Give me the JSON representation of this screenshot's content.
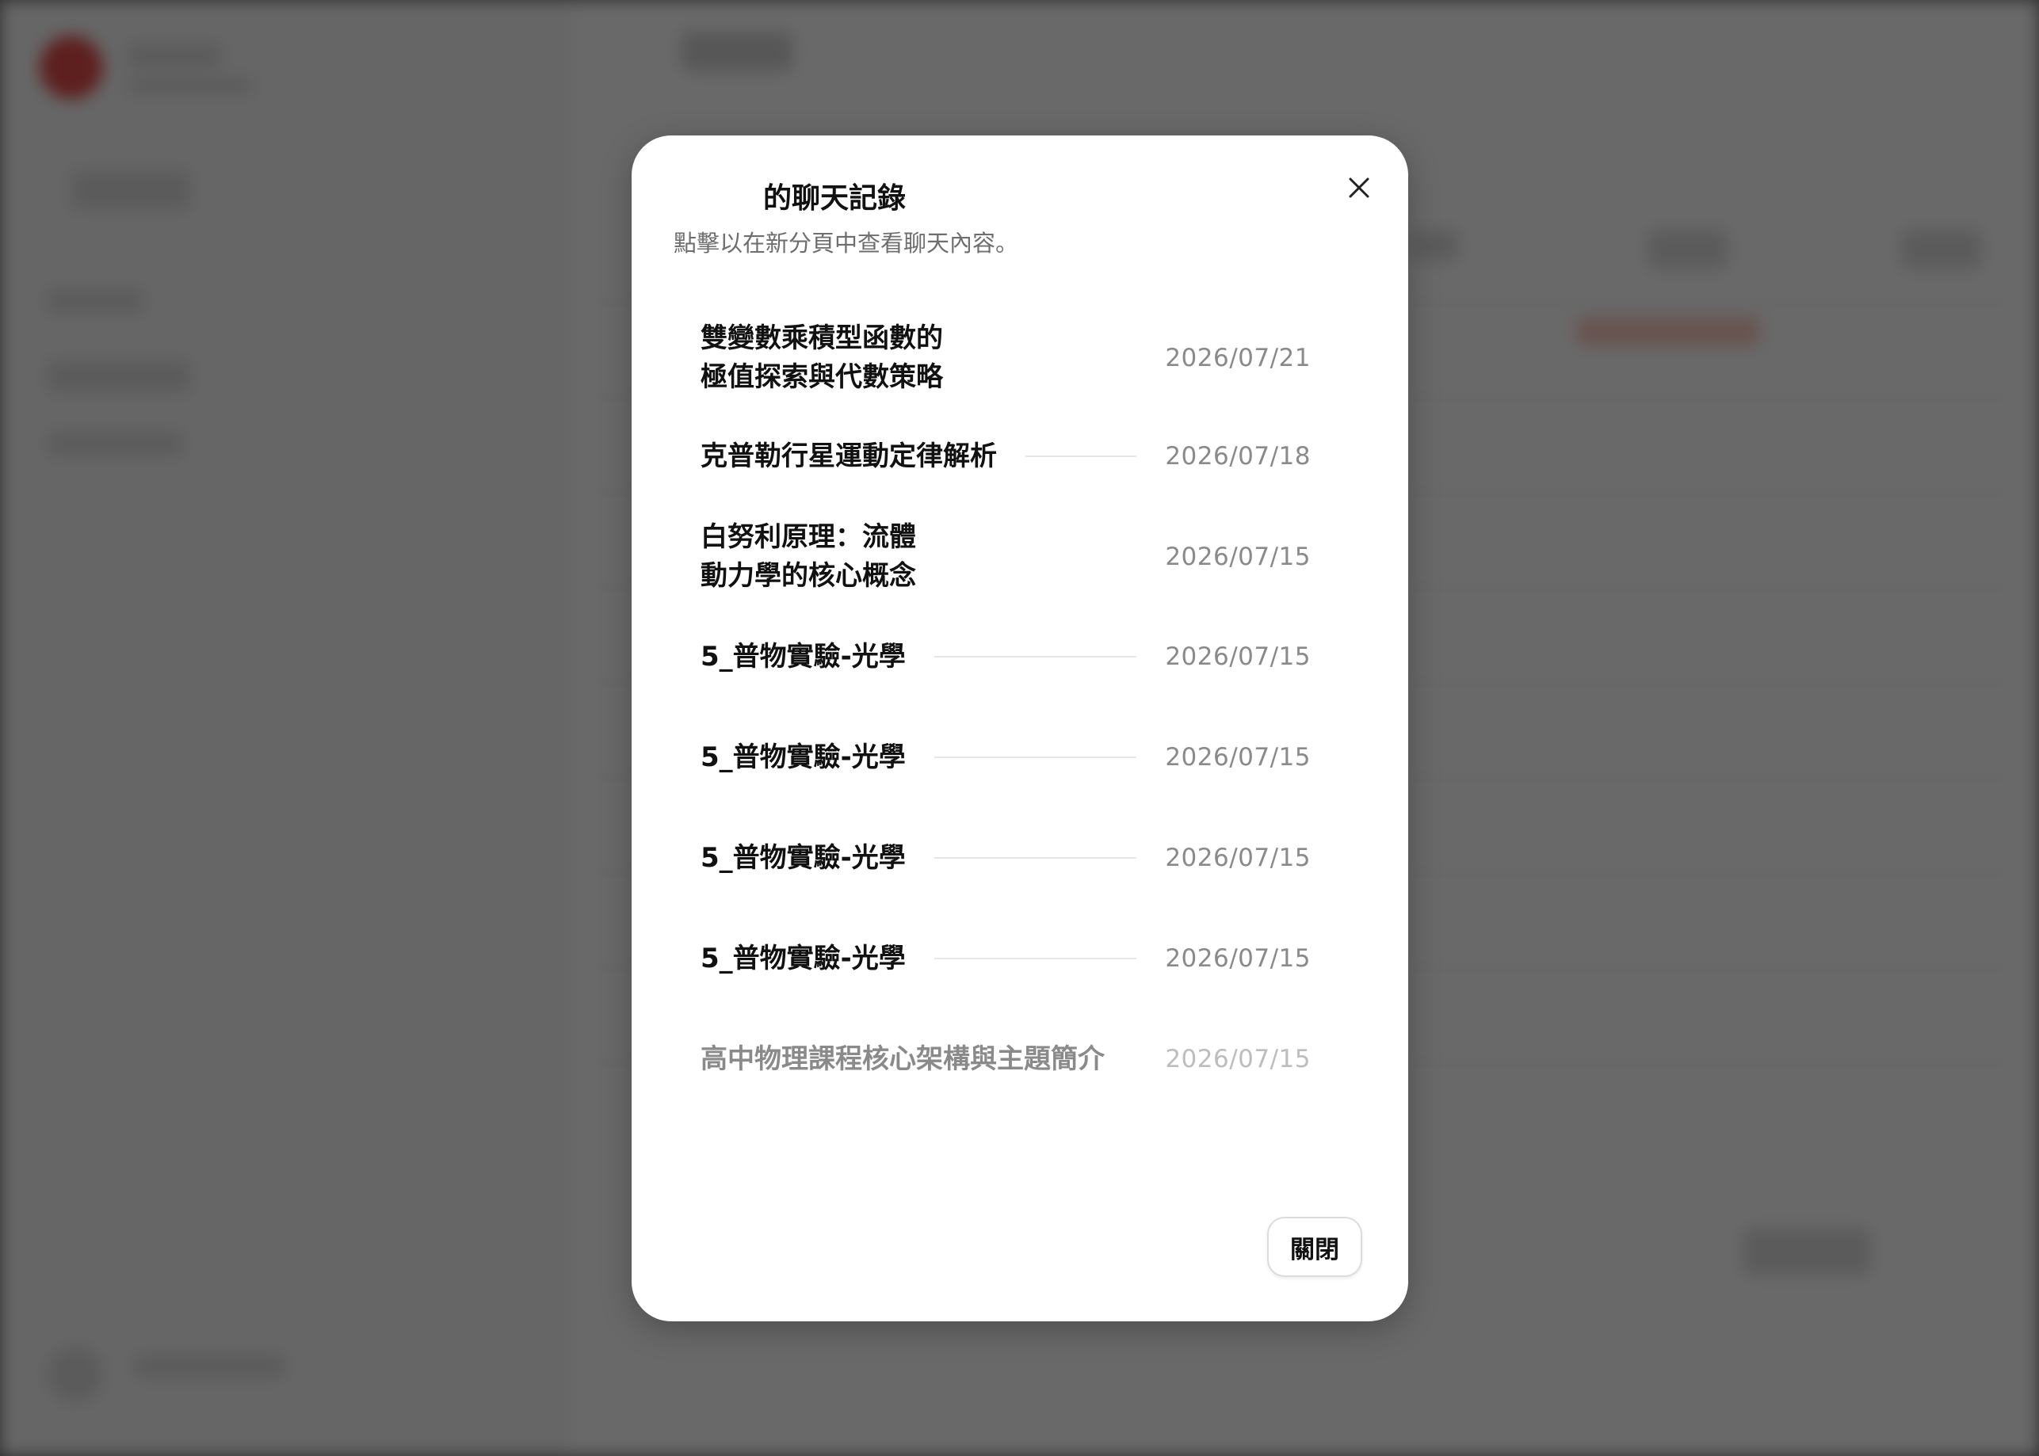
{
  "modal": {
    "title": "的聊天記錄",
    "subtitle": "點擊以在新分頁中查看聊天內容。",
    "close_icon": "close-icon",
    "close_button_label": "關閉",
    "items": [
      {
        "title": "雙變數乘積型函數的\n極值探索與代數策略",
        "date": "2026/07/21"
      },
      {
        "title": "克普勒行星運動定律解析",
        "date": "2026/07/18"
      },
      {
        "title": "白努利原理：流體\n動力學的核心概念",
        "date": "2026/07/15"
      },
      {
        "title": "5_普物實驗-光學",
        "date": "2026/07/15"
      },
      {
        "title": "5_普物實驗-光學",
        "date": "2026/07/15"
      },
      {
        "title": "5_普物實驗-光學",
        "date": "2026/07/15"
      },
      {
        "title": "5_普物實驗-光學",
        "date": "2026/07/15"
      },
      {
        "title": "高中物理課程核心架構與主題簡介",
        "date": "2026/07/15"
      }
    ]
  }
}
